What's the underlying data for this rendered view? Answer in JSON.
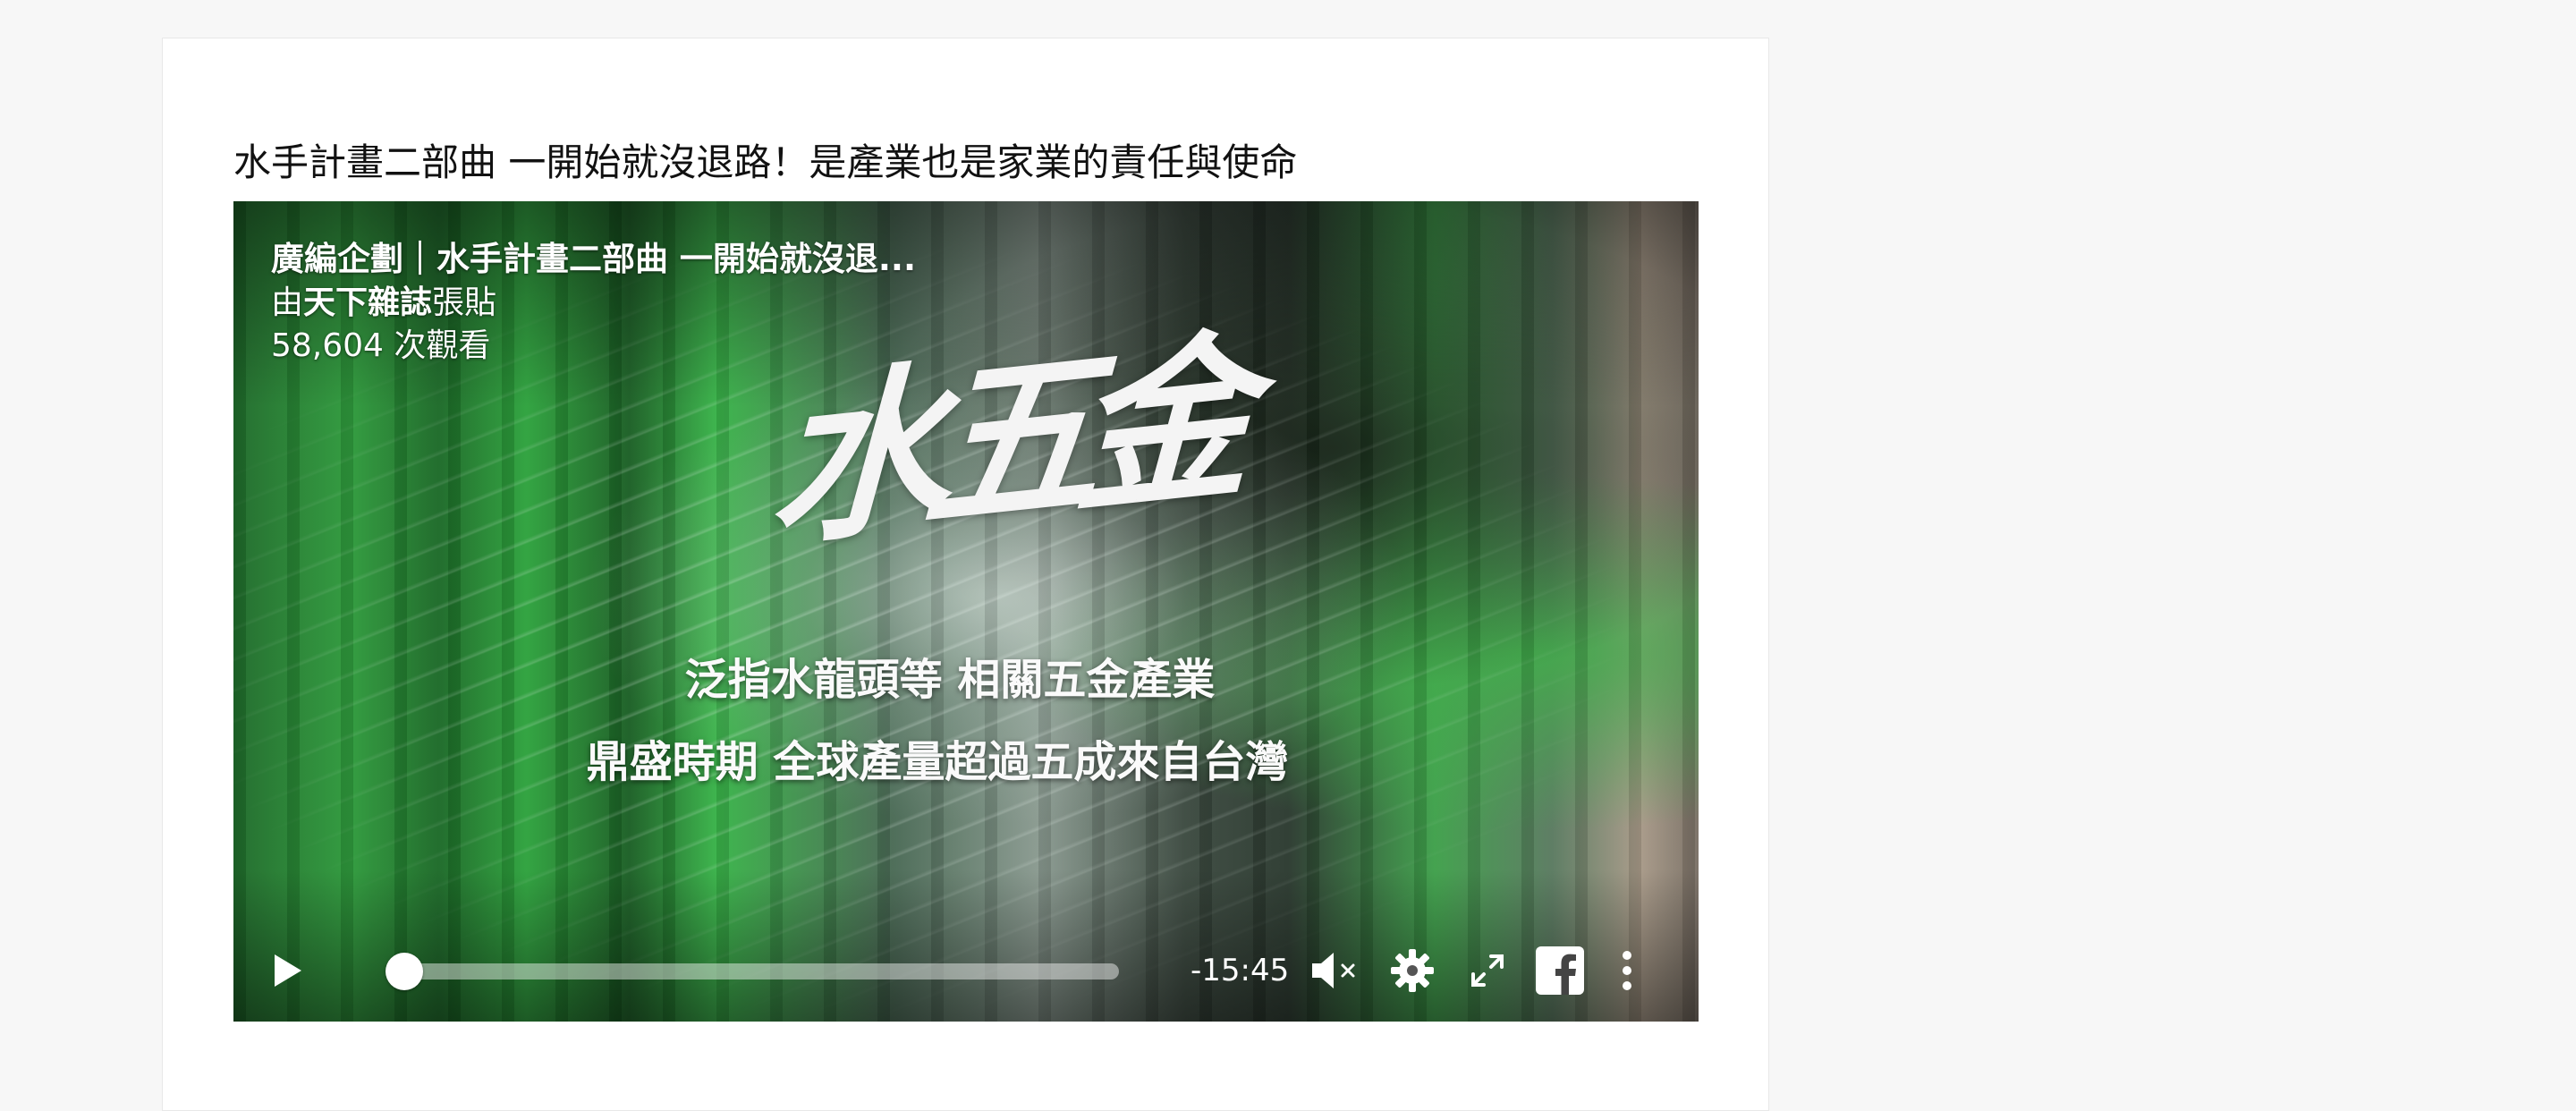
{
  "article": {
    "title": "水手計畫二部曲 一開始就沒退路！是產業也是家業的責任與使命"
  },
  "video": {
    "title": "廣編企劃｜水手計畫二部曲 一開始就沒退...",
    "posted_by_prefix": "由",
    "page_name": "天下雜誌",
    "posted_by_suffix": "張貼",
    "views": "58,604 次觀看",
    "frame_text": {
      "logo": "水五金",
      "caption_line1": "泛指水龍頭等 相關五金產業",
      "caption_line2": "鼎盛時期  全球產量超過五成來自台灣"
    }
  },
  "player_controls": {
    "play_icon": "play-icon",
    "progress_fraction": 0.02,
    "time_remaining": "-15:45",
    "mute_icon": "speaker-muted-icon",
    "settings_icon": "gear-icon",
    "fullscreen_icon": "expand-icon",
    "facebook_icon": "facebook-icon",
    "more_icon": "vertical-dots-icon"
  },
  "colors": {
    "page_background": "#f7f7f7",
    "card_background": "#ffffff",
    "title_text": "#111111",
    "control_foreground": "#ffffff"
  }
}
